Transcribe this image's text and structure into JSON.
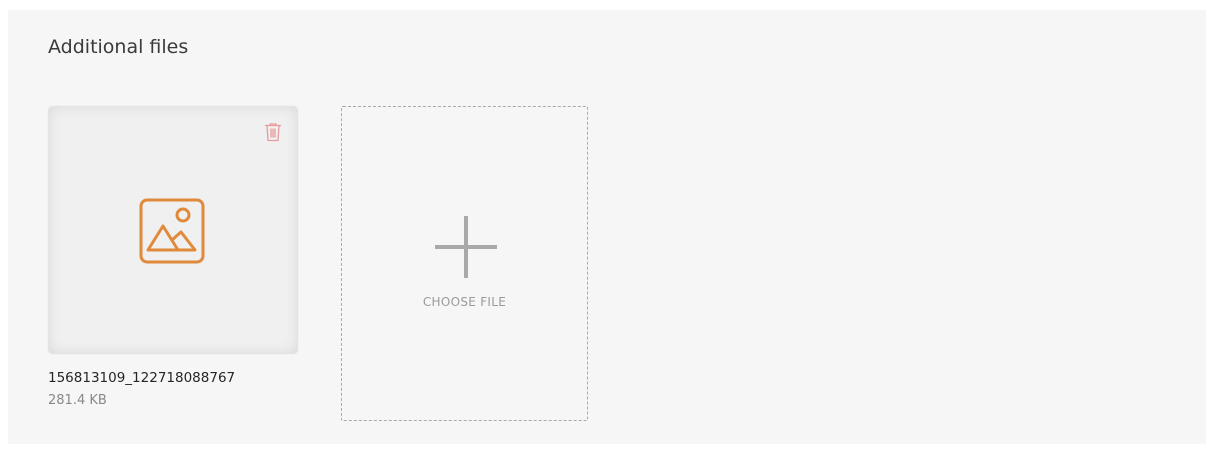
{
  "section": {
    "title": "Additional files"
  },
  "files": [
    {
      "name": "156813109_122718088767",
      "size": "281.4 KB",
      "icon": "image-icon"
    }
  ],
  "uploader": {
    "label": "CHOOSE FILE",
    "icon": "plus-icon"
  },
  "colors": {
    "accent": "#e08a3c",
    "delete": "#e89a9a",
    "panel_bg": "#f6f6f6"
  }
}
